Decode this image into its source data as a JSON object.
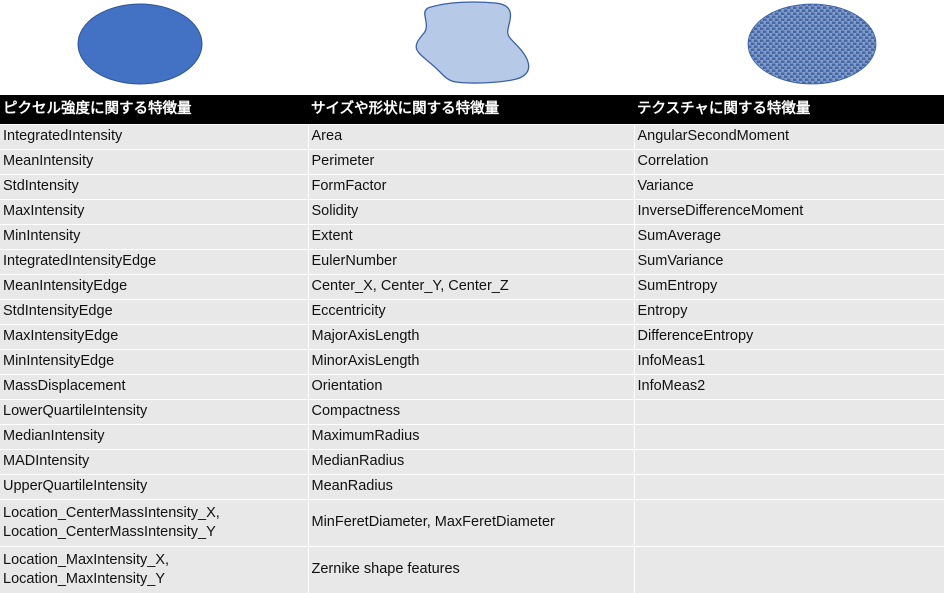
{
  "illustrations": [
    {
      "name": "solid-blue-ellipse",
      "alt": "solid blue filled ellipse",
      "fill": "#4372C4",
      "stroke": "#2E5394",
      "style": "solid"
    },
    {
      "name": "irregular-blob-shape",
      "alt": "irregular light blue blob outline",
      "fill": "#B6CAE8",
      "stroke": "#3A5FA8",
      "style": "outline"
    },
    {
      "name": "textured-blue-ellipse",
      "alt": "blue woven texture filled ellipse",
      "fill": "#5C7FC0",
      "stroke": "#3A5FA8",
      "style": "texture"
    }
  ],
  "table": {
    "headers": [
      "ピクセル強度に関する特徴量",
      "サイズや形状に関する特徴量",
      "テクスチャに関する特徴量"
    ],
    "columns": {
      "intensity": [
        "IntegratedIntensity",
        "MeanIntensity",
        "StdIntensity",
        "MaxIntensity",
        "MinIntensity",
        "IntegratedIntensityEdge",
        "MeanIntensityEdge",
        "StdIntensityEdge",
        "MaxIntensityEdge",
        "MinIntensityEdge",
        "MassDisplacement",
        "LowerQuartileIntensity",
        "MedianIntensity",
        "MADIntensity",
        "UpperQuartileIntensity",
        "Location_CenterMassIntensity_X,\nLocation_CenterMassIntensity_Y",
        "Location_MaxIntensity_X,\nLocation_MaxIntensity_Y"
      ],
      "shape": [
        "Area",
        "Perimeter",
        "FormFactor",
        "Solidity",
        "Extent",
        "EulerNumber",
        "Center_X, Center_Y, Center_Z",
        "Eccentricity",
        "MajorAxisLength",
        "MinorAxisLength",
        "Orientation",
        "Compactness",
        "MaximumRadius",
        "MedianRadius",
        "MeanRadius",
        "MinFeretDiameter, MaxFeretDiameter",
        "Zernike shape features"
      ],
      "texture": [
        "AngularSecondMoment",
        "Correlation",
        "Variance",
        "InverseDifferenceMoment",
        "SumAverage",
        "SumVariance",
        "SumEntropy",
        "Entropy",
        "DifferenceEntropy",
        "InfoMeas1",
        "InfoMeas2",
        "",
        "",
        "",
        "",
        "",
        ""
      ]
    },
    "row_count": 17,
    "tall_rows": [
      15,
      16
    ],
    "colors": {
      "header_background": "#000000",
      "header_text": "#ffffff",
      "cell_background": "#e8e8e8",
      "cell_text": "#111111",
      "grid_line": "#ffffff"
    }
  }
}
